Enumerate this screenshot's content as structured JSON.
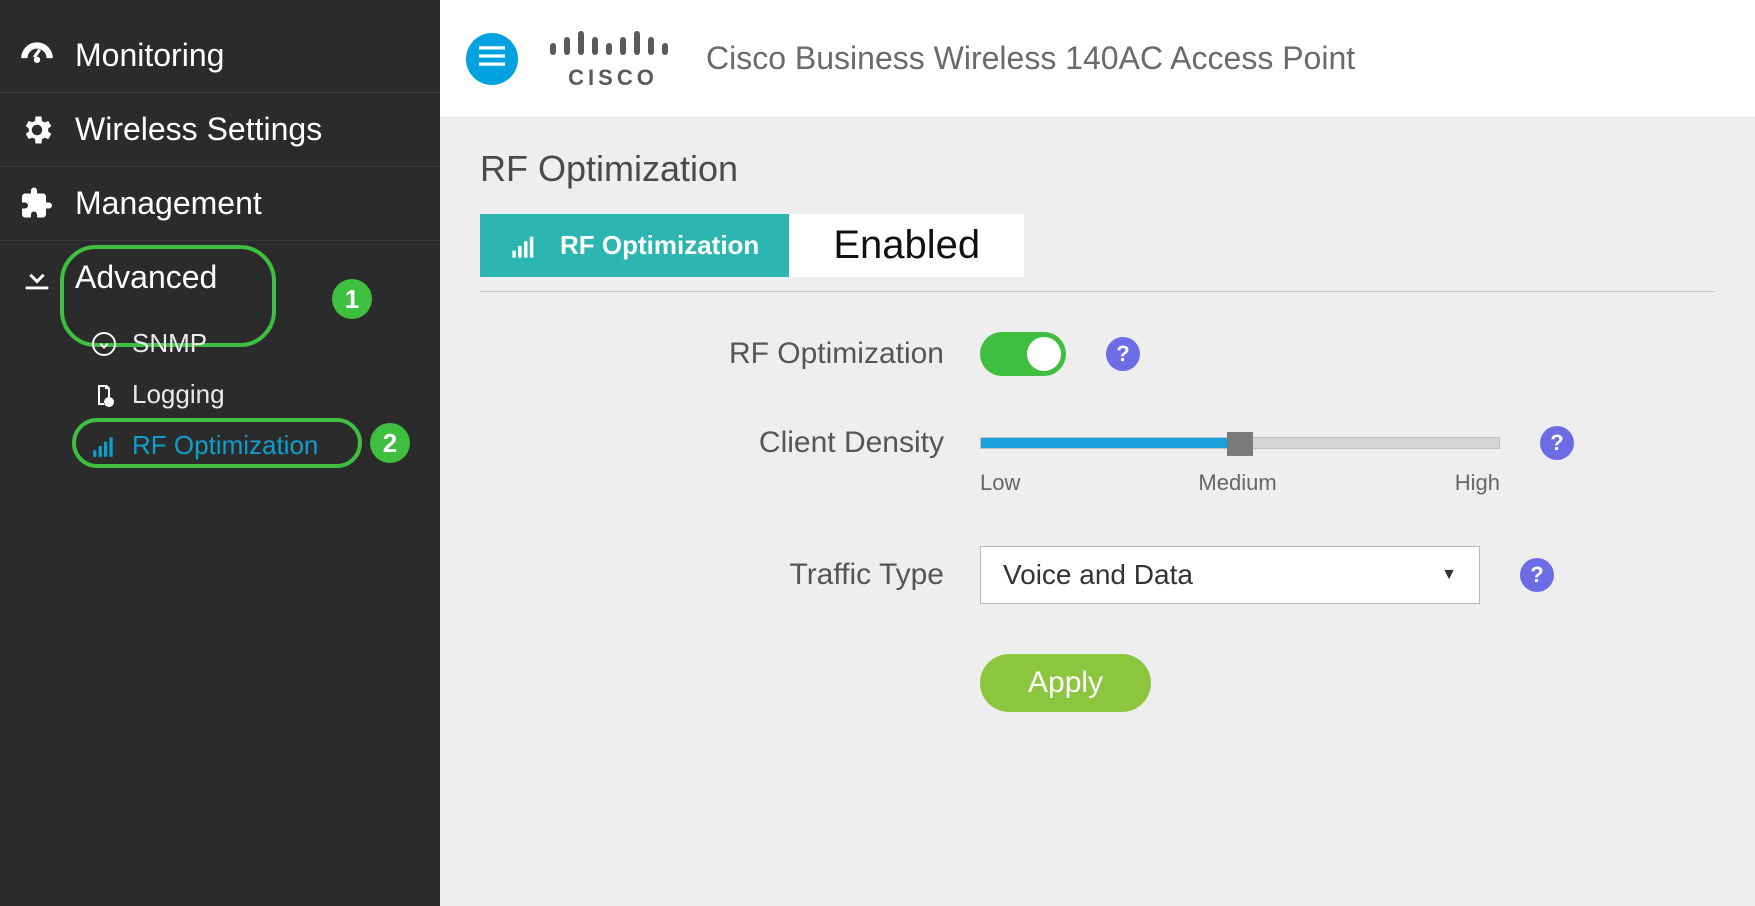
{
  "header": {
    "logo_text": "CISCO",
    "product_title": "Cisco Business Wireless 140AC Access Point"
  },
  "sidebar": {
    "items": [
      {
        "label": "Monitoring"
      },
      {
        "label": "Wireless Settings"
      },
      {
        "label": "Management"
      },
      {
        "label": "Advanced"
      }
    ],
    "advanced_children": [
      {
        "label": "SNMP"
      },
      {
        "label": "Logging"
      },
      {
        "label": "RF Optimization"
      }
    ],
    "callouts": {
      "one": "1",
      "two": "2"
    }
  },
  "content": {
    "section_title": "RF Optimization",
    "status_chip_label": "RF Optimization",
    "status_value": "Enabled",
    "form": {
      "rf_toggle_label": "RF Optimization",
      "client_density_label": "Client Density",
      "slider_ticks": {
        "low": "Low",
        "medium": "Medium",
        "high": "High"
      },
      "traffic_type_label": "Traffic Type",
      "traffic_type_value": "Voice and Data",
      "apply_label": "Apply"
    }
  }
}
